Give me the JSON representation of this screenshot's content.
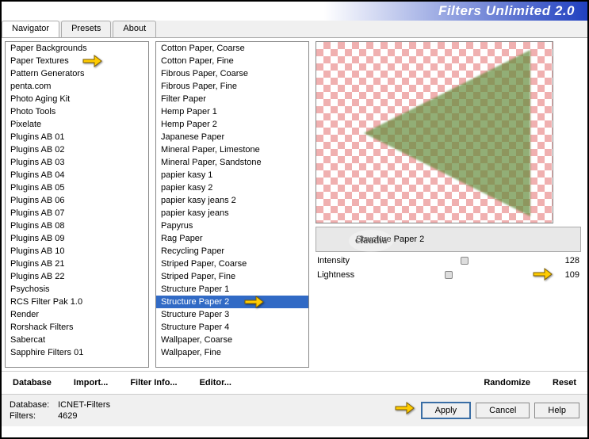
{
  "header": {
    "title": "Filters Unlimited 2.0"
  },
  "tabs": [
    {
      "label": "Navigator",
      "active": true
    },
    {
      "label": "Presets",
      "active": false
    },
    {
      "label": "About",
      "active": false
    }
  ],
  "leftList": {
    "items": [
      "Paper Backgrounds",
      "Paper Textures",
      "Pattern Generators",
      "penta.com",
      "Photo Aging Kit",
      "Photo Tools",
      "Pixelate",
      "Plugins AB 01",
      "Plugins AB 02",
      "Plugins AB 03",
      "Plugins AB 04",
      "Plugins AB 05",
      "Plugins AB 06",
      "Plugins AB 07",
      "Plugins AB 08",
      "Plugins AB 09",
      "Plugins AB 10",
      "Plugins AB 21",
      "Plugins AB 22",
      "Psychosis",
      "RCS Filter Pak 1.0",
      "Render",
      "Rorshack Filters",
      "Sabercat",
      "Sapphire Filters 01"
    ],
    "highlighted": 1
  },
  "rightList": {
    "items": [
      "Cotton Paper, Coarse",
      "Cotton Paper, Fine",
      "Fibrous Paper, Coarse",
      "Fibrous Paper, Fine",
      "Filter Paper",
      "Hemp Paper 1",
      "Hemp Paper 2",
      "Japanese Paper",
      "Mineral Paper, Limestone",
      "Mineral Paper, Sandstone",
      "papier kasy 1",
      "papier kasy 2",
      "papier kasy jeans 2",
      "papier kasy jeans",
      "Papyrus",
      "Rag Paper",
      "Recycling Paper",
      "Striped Paper, Coarse",
      "Striped Paper, Fine",
      "Structure Paper 1",
      "Structure Paper 2",
      "Structure Paper 3",
      "Structure Paper 4",
      "Wallpaper, Coarse",
      "Wallpaper, Fine"
    ],
    "selected": 20
  },
  "preview": {
    "filterName": "Structure Paper 2"
  },
  "sliders": [
    {
      "label": "Intensity",
      "value": 128,
      "pos": 50
    },
    {
      "label": "Lightness",
      "value": 109,
      "pos": 42
    }
  ],
  "toolbar": {
    "database": "Database",
    "import": "Import...",
    "filterInfo": "Filter Info...",
    "editor": "Editor...",
    "randomize": "Randomize",
    "reset": "Reset"
  },
  "footer": {
    "dbLabel": "Database:",
    "dbValue": "ICNET-Filters",
    "filtersLabel": "Filters:",
    "filtersValue": "4629",
    "apply": "Apply",
    "cancel": "Cancel",
    "help": "Help"
  },
  "watermark": "claudia"
}
